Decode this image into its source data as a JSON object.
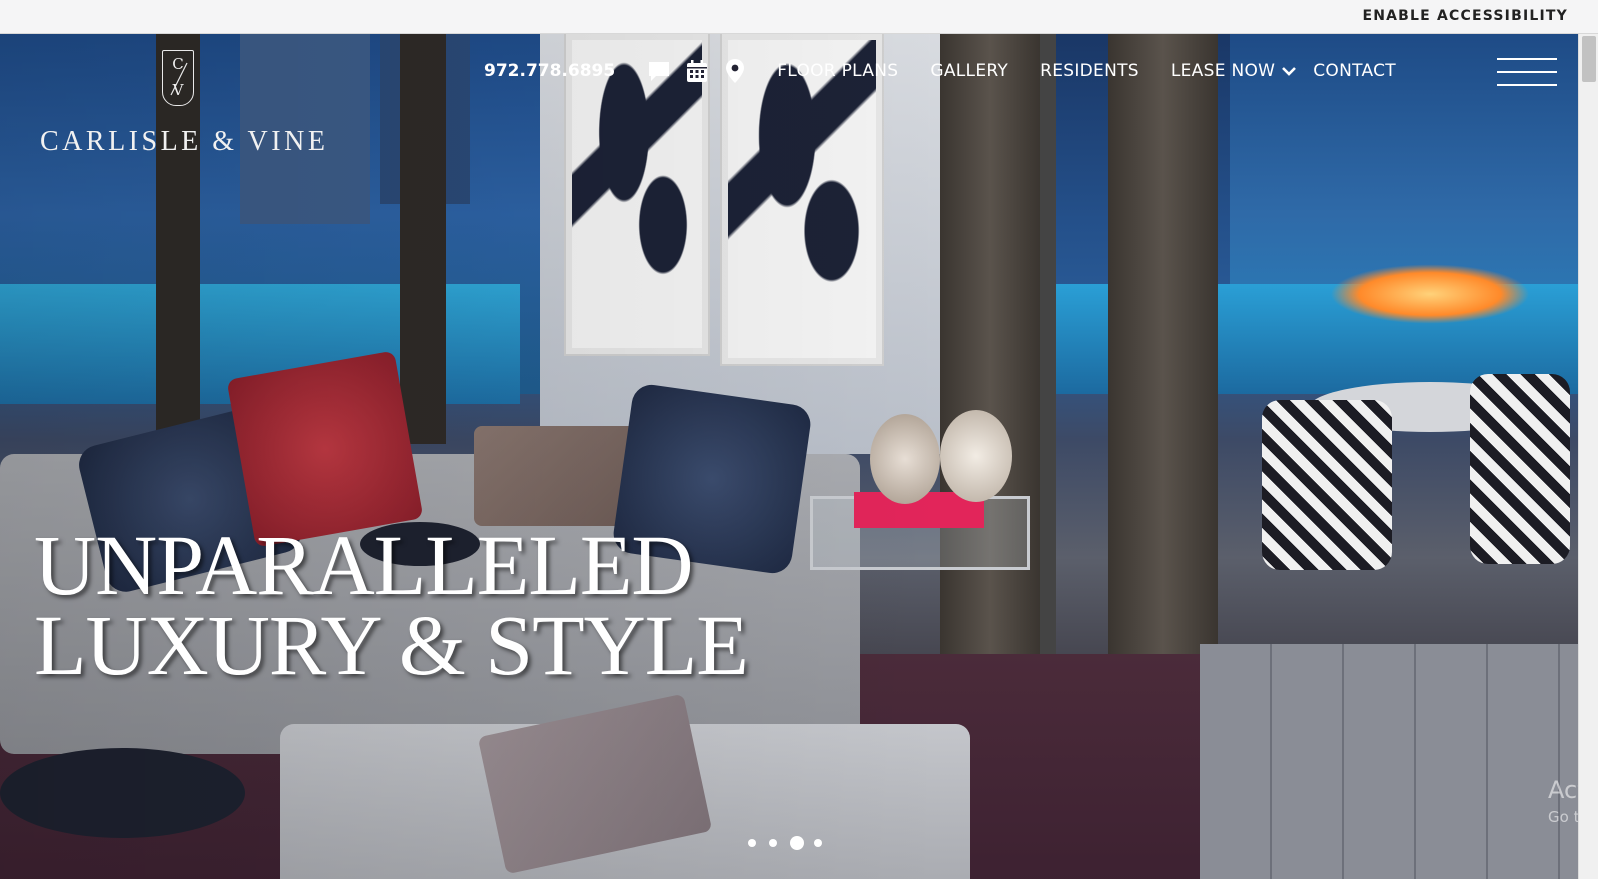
{
  "accessibility": {
    "label": "ENABLE ACCESSIBILITY"
  },
  "brand": {
    "mark_top": "C",
    "mark_bottom": "V",
    "name": "CARLISLE & VINE"
  },
  "nav": {
    "phone": "972.778.6895",
    "icons": [
      "chat-icon",
      "calendar-icon",
      "map-pin-icon"
    ],
    "links": {
      "floor_plans": "FLOOR PLANS",
      "gallery": "GALLERY",
      "residents": "RESIDENTS",
      "lease_now": "LEASE NOW",
      "contact": "CONTACT"
    }
  },
  "hero": {
    "headline_line1": "UNPARALLELED",
    "headline_line2": "LUXURY & STYLE",
    "slides": {
      "count": 4,
      "active_index": 2
    }
  },
  "watermark": {
    "line1": "Activ",
    "line2": "Go to"
  },
  "colors": {
    "nav_text": "#ffffff",
    "top_bar": "#f5f5f6",
    "accent_book": "#e2255a"
  }
}
